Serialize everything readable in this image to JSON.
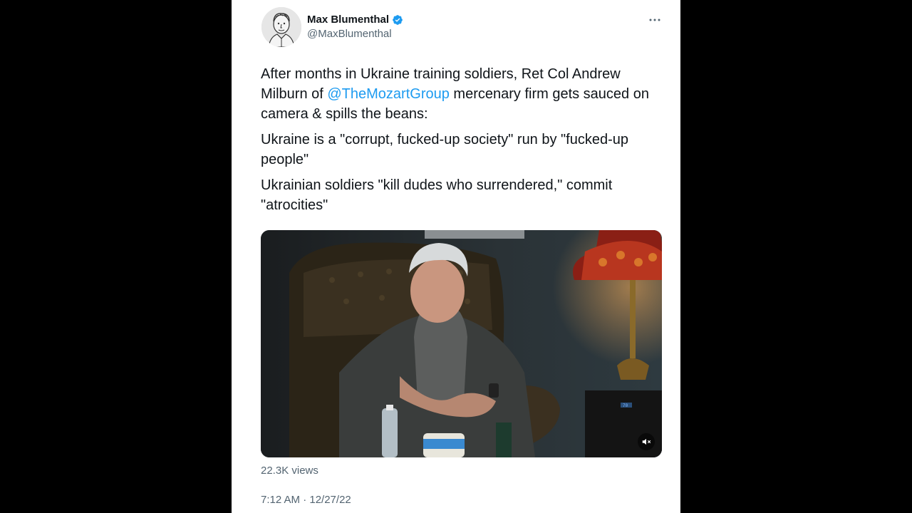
{
  "author": {
    "name": "Max Blumenthal",
    "handle": "@MaxBlumenthal",
    "verified": true
  },
  "tweet": {
    "line1_prefix": "After months in Ukraine training soldiers, Ret Col Andrew Milburn of ",
    "mention": "@TheMozartGroup",
    "line1_suffix": " mercenary firm gets sauced on camera & spills the beans:",
    "paragraph2": "Ukraine is a \"corrupt, fucked-up society\" run by \"fucked-up people\"",
    "paragraph3": "Ukrainian soldiers \"kill dudes who surrendered,\" commit \"atrocities\""
  },
  "media": {
    "type": "video",
    "muted": true,
    "mute_icon": "speaker-muted-icon"
  },
  "stats": {
    "views": "22.3K views"
  },
  "timestamp": "7:12 AM · 12/27/22",
  "colors": {
    "background": "#000000",
    "card": "#ffffff",
    "text": "#0f1419",
    "secondary": "#536471",
    "link": "#1d9bf0"
  }
}
